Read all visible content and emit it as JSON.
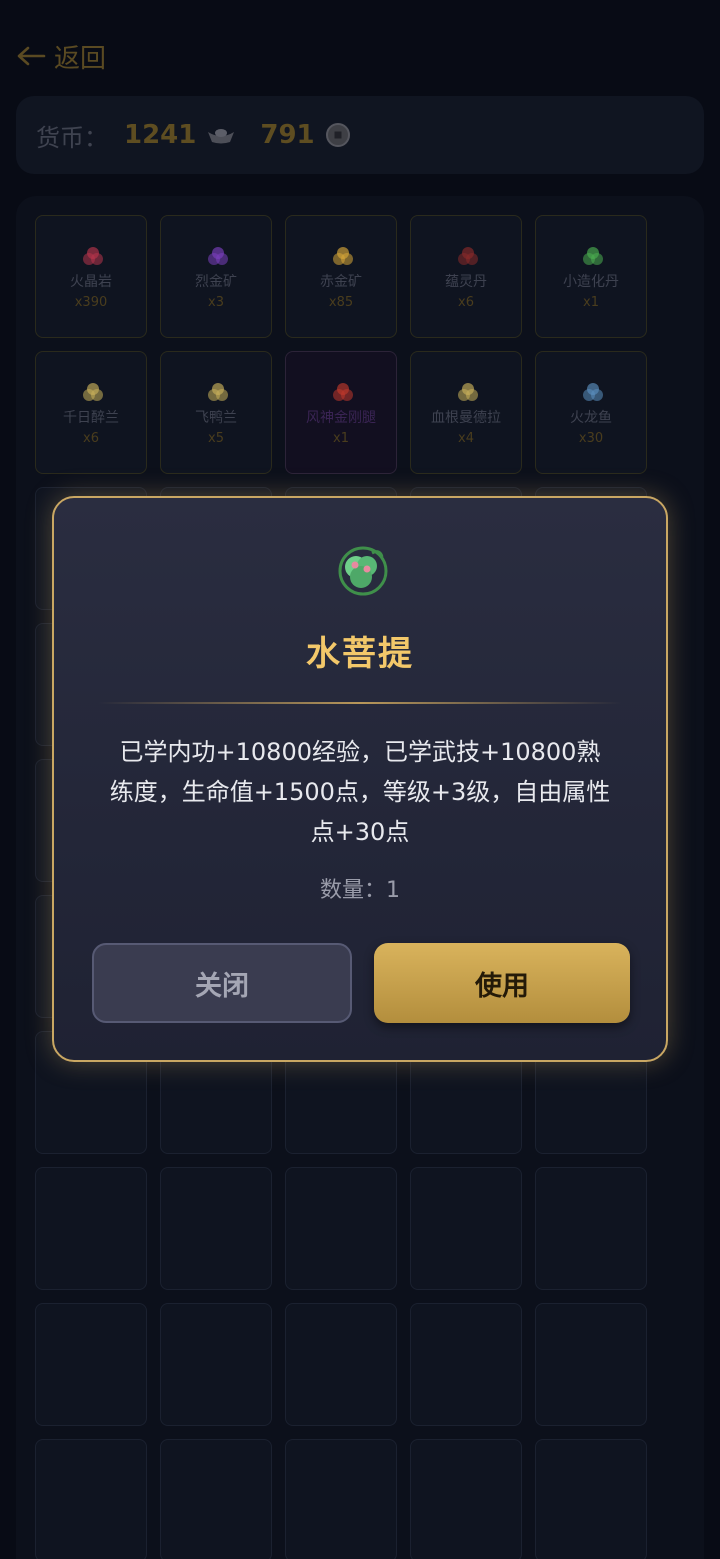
{
  "header": {
    "back_label": "返回"
  },
  "currency": {
    "label": "货币：",
    "ingots": "1241",
    "coins": "791"
  },
  "inventory": {
    "items": [
      {
        "name": "火晶岩",
        "qty": "x390",
        "icon": "red-crystal-cluster-icon",
        "color": "#b8344c"
      },
      {
        "name": "烈金矿",
        "qty": "x3",
        "icon": "purple-ore-icon",
        "color": "#7b3fbf"
      },
      {
        "name": "赤金矿",
        "qty": "x85",
        "icon": "gold-ore-icon",
        "color": "#d8a739"
      },
      {
        "name": "蕴灵丹",
        "qty": "x6",
        "icon": "dark-red-pill-icon",
        "color": "#8b2a2a"
      },
      {
        "name": "小造化丹",
        "qty": "x1",
        "icon": "green-potion-icon",
        "color": "#4caf50"
      },
      {
        "name": "千日醉兰",
        "qty": "x6",
        "icon": "yellow-orchid-icon",
        "color": "#c9b15a"
      },
      {
        "name": "飞鸭兰",
        "qty": "x5",
        "icon": "yellow-orchid-icon",
        "color": "#c9b15a"
      },
      {
        "name": "风神金刚腿",
        "qty": "x1",
        "icon": "red-weapon-icon",
        "color": "#c0392b",
        "rare": true
      },
      {
        "name": "血根曼德拉",
        "qty": "x4",
        "icon": "yellow-orchid-icon",
        "color": "#c9b15a"
      },
      {
        "name": "火龙鱼",
        "qty": "x30",
        "icon": "blue-fish-icon",
        "color": "#5b8fbf"
      }
    ]
  },
  "modal": {
    "icon": "water-bodhi-fruit-icon",
    "title": "水菩提",
    "description": "已学内功+10800经验，已学武技+10800熟练度，生命值+1500点，等级+3级，自由属性点+30点",
    "count_label": "数量：1",
    "close_label": "关闭",
    "use_label": "使用"
  },
  "colors": {
    "accent_gold": "#f3c86a",
    "border_gold": "#c9a763",
    "background": "#080b15"
  }
}
